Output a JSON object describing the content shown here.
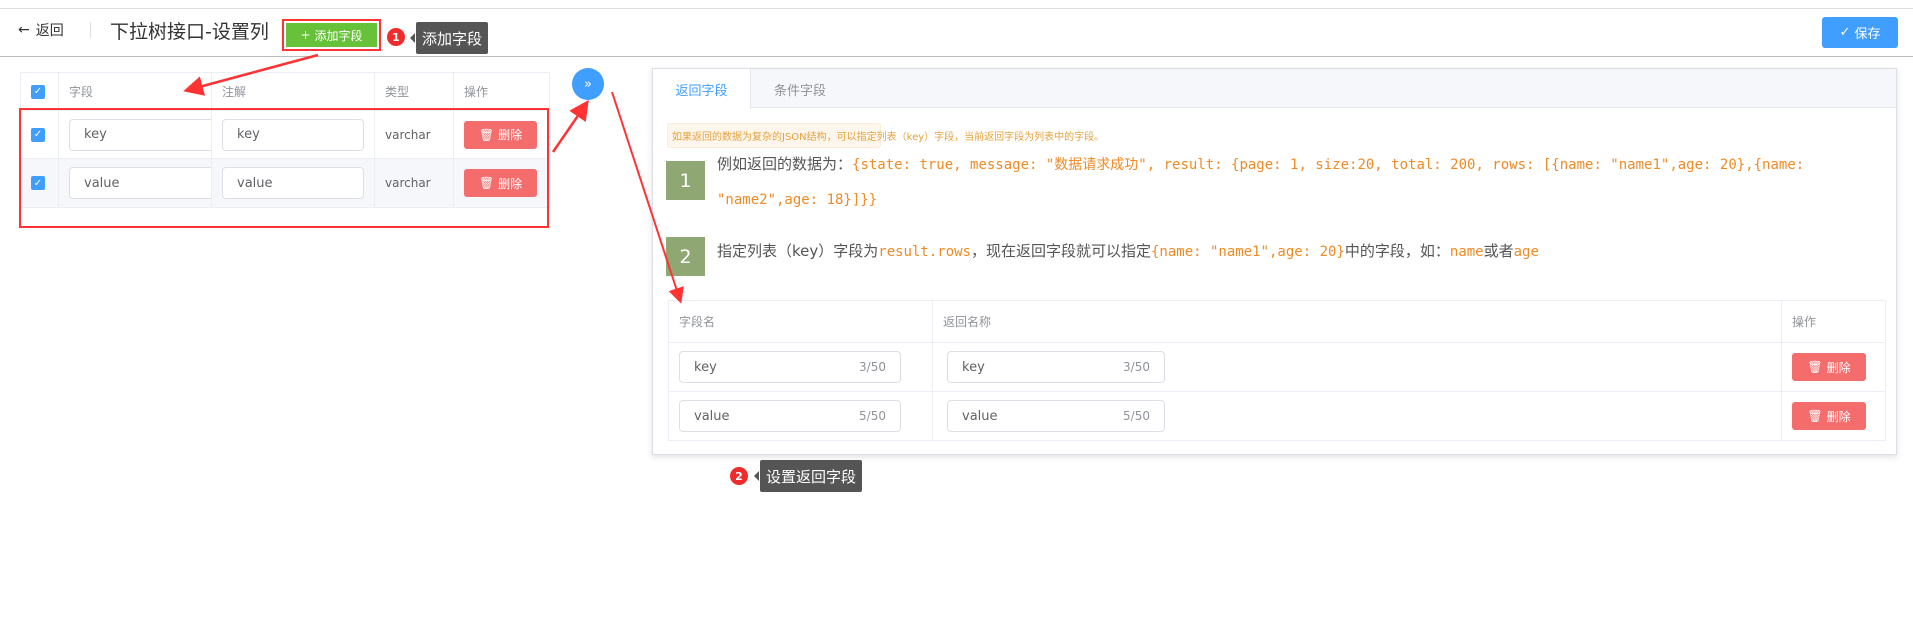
{
  "header": {
    "back_label": "返回",
    "title": "下拉树接口-设置列",
    "add_field_label": "添加字段",
    "save_label": "保存"
  },
  "annotations": {
    "step1_badge": "1",
    "step1_tip": "添加字段",
    "step2_badge": "2",
    "step2_tip": "设置返回字段"
  },
  "left_table": {
    "columns": [
      "字段",
      "注解",
      "类型",
      "操作"
    ],
    "rows": [
      {
        "field": "key",
        "comment": "key",
        "type": "varchar",
        "delete": "删除",
        "checked": true
      },
      {
        "field": "value",
        "comment": "value",
        "type": "varchar",
        "delete": "删除",
        "checked": true
      }
    ]
  },
  "expand_icon": "»",
  "panel": {
    "tabs": [
      "返回字段",
      "条件字段"
    ],
    "active_tab": 0,
    "alert": "如果返回的数据为复杂的JSON结构，可以指定列表（key）字段，当前返回字段为列表中的字段。",
    "steps": [
      {
        "num": "1",
        "prefix": "例如返回的数据为：",
        "code": "{state: true, message: \"数据请求成功\", result: {page: 1, size:20, total: 200, rows: [{name: \"name1\",age: 20},{name: \"name2\",age: 18}]}}"
      },
      {
        "num": "2",
        "t1": "指定列表（key）字段为",
        "c1": "result.rows",
        "t2": "，现在返回字段就可以指定",
        "c2": "{name: \"name1\",age: 20}",
        "t3": "中的字段，如：",
        "c3": "name",
        "t4": "或者",
        "c4": "age"
      }
    ],
    "table": {
      "columns": [
        "字段名",
        "返回名称",
        "操作"
      ],
      "rows": [
        {
          "field": "key",
          "field_count": "3/50",
          "name": "key",
          "name_count": "3/50",
          "delete": "删除"
        },
        {
          "field": "value",
          "field_count": "5/50",
          "name": "value",
          "name_count": "5/50",
          "delete": "删除"
        }
      ]
    }
  },
  "colors": {
    "primary": "#409eff",
    "success": "#67c23a",
    "danger": "#f56c6c",
    "annotation": "#f02b2b",
    "code": "#f08a24"
  }
}
